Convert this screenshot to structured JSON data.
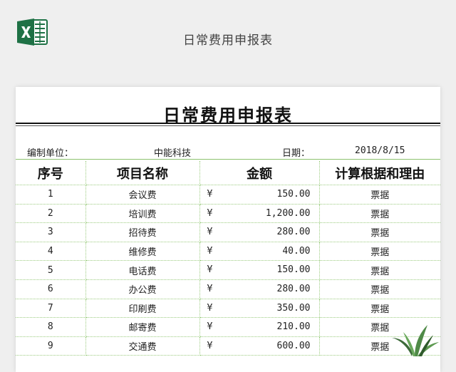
{
  "header": {
    "title": "日常费用申报表",
    "logo_icon": "excel-logo-icon",
    "logo_color": "#1e7145"
  },
  "sheet": {
    "title": "日常费用申报表",
    "info": {
      "unit_label": "编制单位：",
      "unit_value": "中能科技",
      "date_label": "日期：",
      "date_value": "2018/8/15"
    },
    "columns": [
      "序号",
      "项目名称",
      "金额",
      "计算根据和理由"
    ],
    "currency_symbol": "¥",
    "rows": [
      {
        "no": "1",
        "name": "会议费",
        "amount": "150.00",
        "basis": "票据"
      },
      {
        "no": "2",
        "name": "培训费",
        "amount": "1,200.00",
        "basis": "票据"
      },
      {
        "no": "3",
        "name": "招待费",
        "amount": "280.00",
        "basis": "票据"
      },
      {
        "no": "4",
        "name": "维修费",
        "amount": "40.00",
        "basis": "票据"
      },
      {
        "no": "5",
        "name": "电话费",
        "amount": "150.00",
        "basis": "票据"
      },
      {
        "no": "6",
        "name": "办公费",
        "amount": "280.00",
        "basis": "票据"
      },
      {
        "no": "7",
        "name": "印刷费",
        "amount": "350.00",
        "basis": "票据"
      },
      {
        "no": "8",
        "name": "邮寄费",
        "amount": "210.00",
        "basis": "票据"
      },
      {
        "no": "9",
        "name": "交通费",
        "amount": "600.00",
        "basis": "票据"
      }
    ],
    "grid_color": "#9ccc80",
    "decor_icon": "plant-icon"
  }
}
